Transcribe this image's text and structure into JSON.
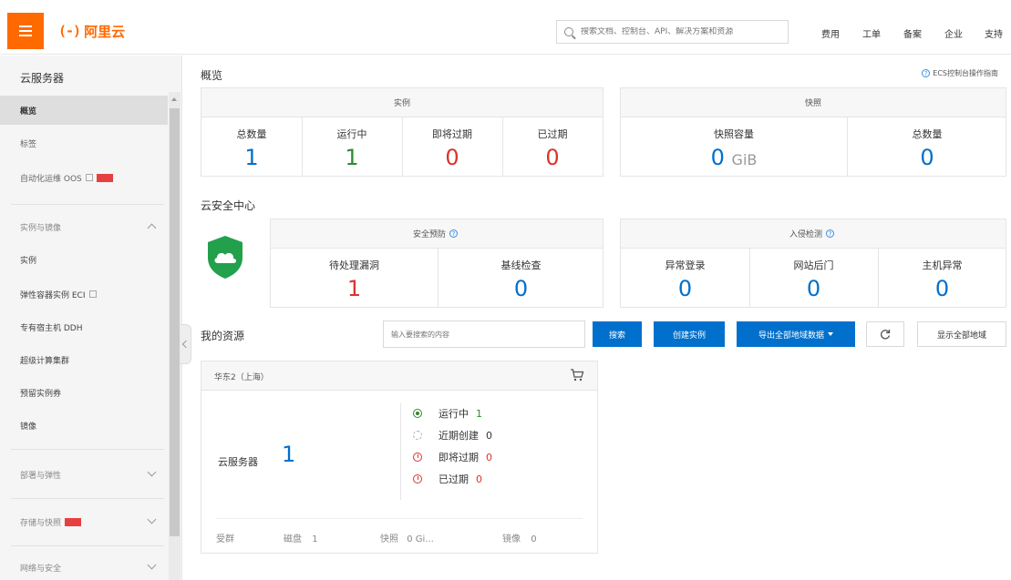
{
  "header": {
    "logo_text": "阿里云",
    "search_placeholder": "搜索文档、控制台、API、解决方案和资源",
    "links": [
      "费用",
      "工单",
      "备案",
      "企业",
      "支持"
    ]
  },
  "sidebar": {
    "title": "云服务器",
    "items_top": [
      {
        "label": "概览"
      },
      {
        "label": "标签"
      },
      {
        "label": "自动化运维 OOS"
      }
    ],
    "group_instances": "实例与镜像",
    "items_instances": [
      {
        "label": "实例"
      },
      {
        "label": "弹性容器实例 ECI"
      },
      {
        "label": "专有宿主机 DDH"
      },
      {
        "label": "超级计算集群"
      },
      {
        "label": "预留实例券"
      },
      {
        "label": "镜像"
      }
    ],
    "group_deploy": "部署与弹性",
    "group_storage": "存储与快照",
    "group_network": "网络与安全"
  },
  "overview": {
    "title": "概览",
    "guide_link": "ECS控制台操作指南",
    "instances": {
      "title": "实例",
      "stats": [
        {
          "label": "总数量",
          "value": "1"
        },
        {
          "label": "运行中",
          "value": "1"
        },
        {
          "label": "即将过期",
          "value": "0"
        },
        {
          "label": "已过期",
          "value": "0"
        }
      ]
    },
    "snapshots": {
      "title": "快照",
      "capacity_label": "快照容量",
      "capacity_value": "0",
      "capacity_unit": "GiB",
      "total_label": "总数量",
      "total_value": "0"
    }
  },
  "security": {
    "title": "云安全中心",
    "prevention": {
      "title": "安全预防",
      "stats": [
        {
          "label": "待处理漏洞",
          "value": "1"
        },
        {
          "label": "基线检查",
          "value": "0"
        }
      ]
    },
    "intrusion": {
      "title": "入侵检测",
      "stats": [
        {
          "label": "异常登录",
          "value": "0"
        },
        {
          "label": "网站后门",
          "value": "0"
        },
        {
          "label": "主机异常",
          "value": "0"
        }
      ]
    }
  },
  "resources": {
    "title": "我的资源",
    "search_placeholder": "输入要搜索的内容",
    "search_button": "搜索",
    "create_button": "创建实例",
    "export_button": "导出全部地域数据",
    "show_all_button": "显示全部地域",
    "region": {
      "name": "华东2（上海）",
      "label": "云服务器",
      "count": "1",
      "statuses": [
        {
          "label": "运行中",
          "value": "1"
        },
        {
          "label": "近期创建",
          "value": "0"
        },
        {
          "label": "即将过期",
          "value": "0"
        },
        {
          "label": "已过期",
          "value": "0"
        }
      ],
      "footer": [
        {
          "label": "受群",
          "value": ""
        },
        {
          "label": "磁盘",
          "value": "1"
        },
        {
          "label": "快照",
          "value": "0 Gi..."
        },
        {
          "label": "镜像",
          "value": "0"
        }
      ]
    }
  },
  "colors": {
    "brand": "#ff6a00",
    "primary": "#0070cc",
    "running": "#2e8b2e",
    "danger": "#d9342b",
    "shield": "#22a04b"
  }
}
